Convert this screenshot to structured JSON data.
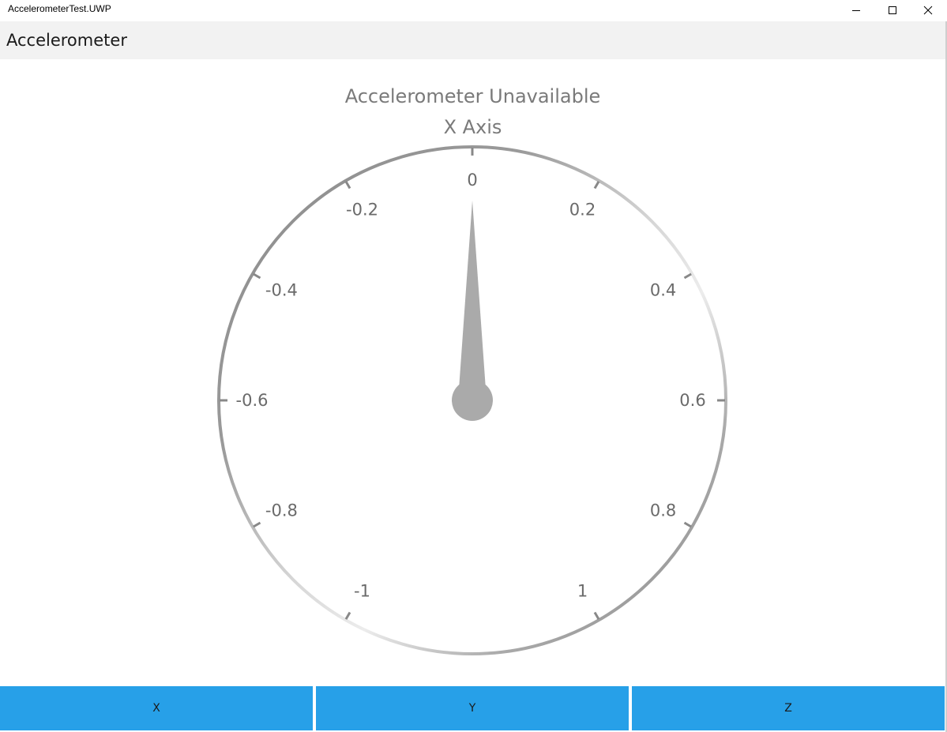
{
  "window": {
    "title": "AccelerometerTest.UWP",
    "controls": {
      "minimize_icon": "minimize-icon",
      "maximize_icon": "maximize-icon",
      "close_icon": "close-icon"
    }
  },
  "header": {
    "title": "Accelerometer"
  },
  "main": {
    "status": "Accelerometer Unavailable",
    "axis_label": "X Axis"
  },
  "gauge": {
    "min": -1,
    "max": 1,
    "value": 0,
    "ticks": [
      {
        "value": -1,
        "label": "-1"
      },
      {
        "value": -0.8,
        "label": "-0.8"
      },
      {
        "value": -0.6,
        "label": "-0.6"
      },
      {
        "value": -0.4,
        "label": "-0.4"
      },
      {
        "value": -0.2,
        "label": "-0.2"
      },
      {
        "value": 0,
        "label": "0"
      },
      {
        "value": 0.2,
        "label": "0.2"
      },
      {
        "value": 0.4,
        "label": "0.4"
      },
      {
        "value": 0.6,
        "label": "0.6"
      },
      {
        "value": 0.8,
        "label": "0.8"
      },
      {
        "value": 1,
        "label": "1"
      }
    ],
    "colors": {
      "needle": "#aaaaaa",
      "tick": "#888888",
      "tick_label": "#6a6a6a",
      "ring_dark": "#8a8a8a",
      "ring_light": "#e4e4e4"
    }
  },
  "buttons": [
    {
      "label": "X"
    },
    {
      "label": "Y"
    },
    {
      "label": "Z"
    }
  ],
  "colors": {
    "button_background": "#27a0e8",
    "header_background": "#f2f2f2"
  }
}
